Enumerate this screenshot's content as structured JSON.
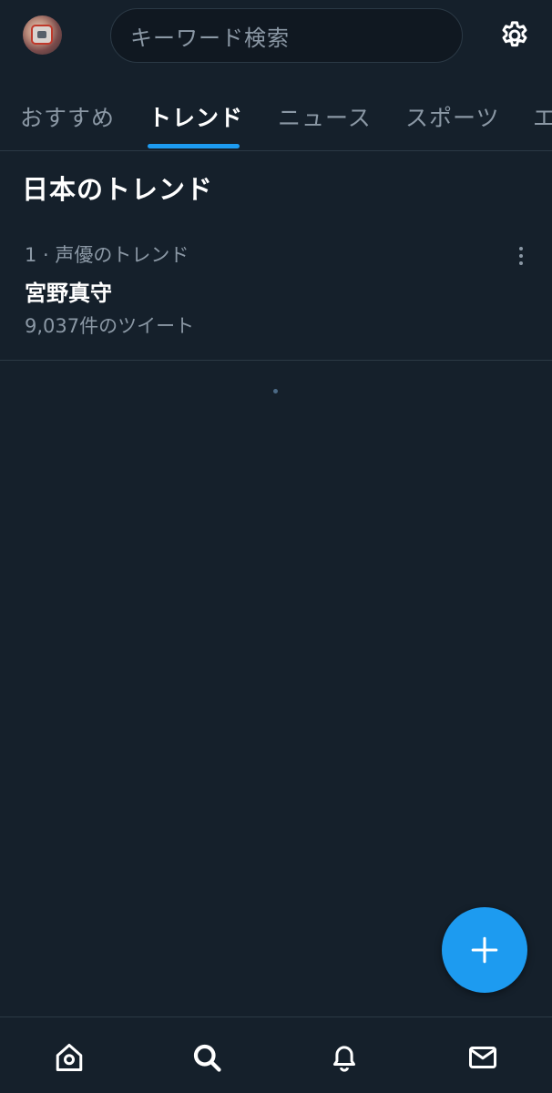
{
  "header": {
    "search_placeholder": "キーワード検索",
    "avatar_icon": "profile-avatar",
    "settings_icon": "gear-icon"
  },
  "tabs": [
    {
      "label": "おすすめ",
      "active": false
    },
    {
      "label": "トレンド",
      "active": true
    },
    {
      "label": "ニュース",
      "active": false
    },
    {
      "label": "スポーツ",
      "active": false
    },
    {
      "label": "エ",
      "active": false
    }
  ],
  "section": {
    "title": "日本のトレンド"
  },
  "trends": [
    {
      "context": "1 · 声優のトレンド",
      "name": "宮野真守",
      "count": "9,037件のツイート"
    }
  ],
  "fab": {
    "icon": "plus-icon"
  },
  "bottom_nav": [
    {
      "icon": "home-icon"
    },
    {
      "icon": "search-icon"
    },
    {
      "icon": "bell-icon"
    },
    {
      "icon": "mail-icon"
    }
  ],
  "colors": {
    "background": "#15202b",
    "accent": "#1d9bf0",
    "muted_text": "#8b98a5",
    "divider": "#2b3945"
  }
}
